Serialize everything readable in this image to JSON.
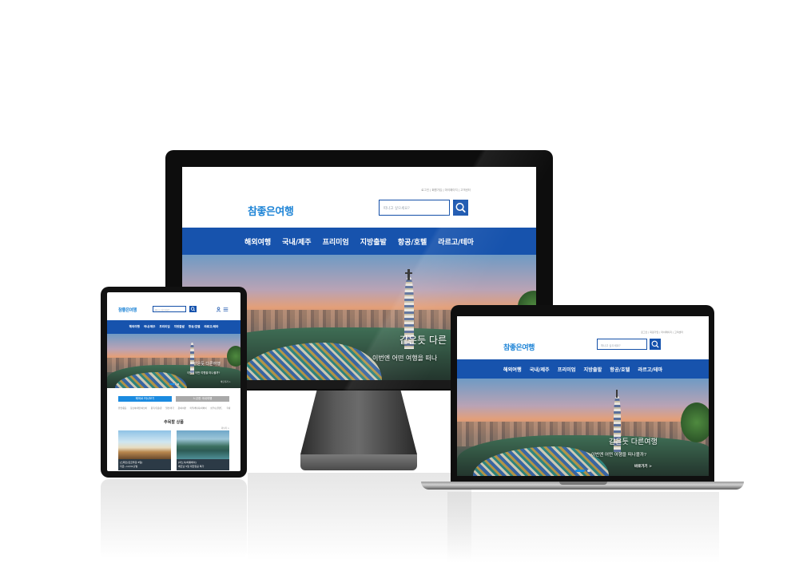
{
  "site": {
    "logo": "참좋은여행",
    "search_placeholder": "떠나고 싶으세요?",
    "search_placeholder_short": "떠나고 싶으세요?",
    "util_links": "로그인 | 회원가입 | 마이페이지 | 고객센터",
    "nav": [
      "해외여행",
      "국내/제주",
      "프리미엄",
      "지방출발",
      "항공/호텔",
      "라르고/테마"
    ],
    "hero_line1": "같은듯 다른",
    "hero_line2": "이번엔 어떤 여행을 떠나",
    "hero_line1_full": "같은듯 다른여행",
    "hero_line2_full": "이번엔 어떤 여행을 떠나볼까?",
    "hero_cta": "바로가기 >"
  },
  "tablet": {
    "button_primary": "해외로 떠나보기",
    "button_secondary": "느긋한 국내여행",
    "quick_links": [
      "유럽/중동",
      "동남아/대만/서남아",
      "중국/홍콩/괌",
      "일본/미국",
      "괌/사이판",
      "미주/캐나다/하와이",
      "호주/뉴질랜드",
      "국내",
      "유럽/중동"
    ],
    "section_title": "추목할 상품",
    "more": "더보기 >",
    "cards": [
      {
        "caption": "[스페인/포르투갈 8일]",
        "sub": "지금~12/31출발"
      },
      {
        "caption": "[하노이/하롱베이]",
        "sub": "베트남 5일 대한항공 특가"
      }
    ]
  },
  "colors": {
    "nav_blue": "#1753ad",
    "logo_blue": "#1e84d6",
    "button_blue": "#1b8be0",
    "button_gray": "#a9a9a9"
  }
}
